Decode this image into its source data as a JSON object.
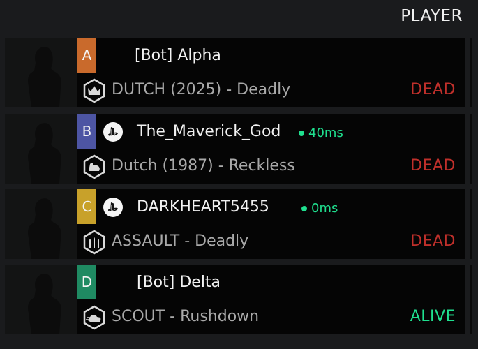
{
  "header": {
    "title": "PLAYER"
  },
  "colors": {
    "dead": "#c0302b",
    "alive": "#1fe08f",
    "ping": "#1fe08f"
  },
  "players": [
    {
      "badge": "A",
      "badge_color": "#c96a2c",
      "platform_icon": "",
      "name": "[Bot] Alpha",
      "ping": "",
      "class_icon": "crown-icon",
      "loadout": "DUTCH (2025) - Deadly",
      "status": "DEAD",
      "status_color": "#c0302b"
    },
    {
      "badge": "B",
      "badge_color": "#4d55a3",
      "platform_icon": "playstation-icon",
      "name": "The_Maverick_God",
      "ping": "40ms",
      "class_icon": "flex-arm-icon",
      "loadout": "Dutch (1987) - Reckless",
      "status": "DEAD",
      "status_color": "#c0302b"
    },
    {
      "badge": "C",
      "badge_color": "#c8a12a",
      "platform_icon": "playstation-icon",
      "name": "DARKHEART5455",
      "ping": "0ms",
      "class_icon": "bullets-icon",
      "loadout": "ASSAULT - Deadly",
      "status": "DEAD",
      "status_color": "#c0302b"
    },
    {
      "badge": "D",
      "badge_color": "#1f8a62",
      "platform_icon": "",
      "name": "[Bot] Delta",
      "ping": "",
      "class_icon": "scout-boot-icon",
      "loadout": "SCOUT - Rushdown",
      "status": "ALIVE",
      "status_color": "#1fe08f"
    }
  ]
}
